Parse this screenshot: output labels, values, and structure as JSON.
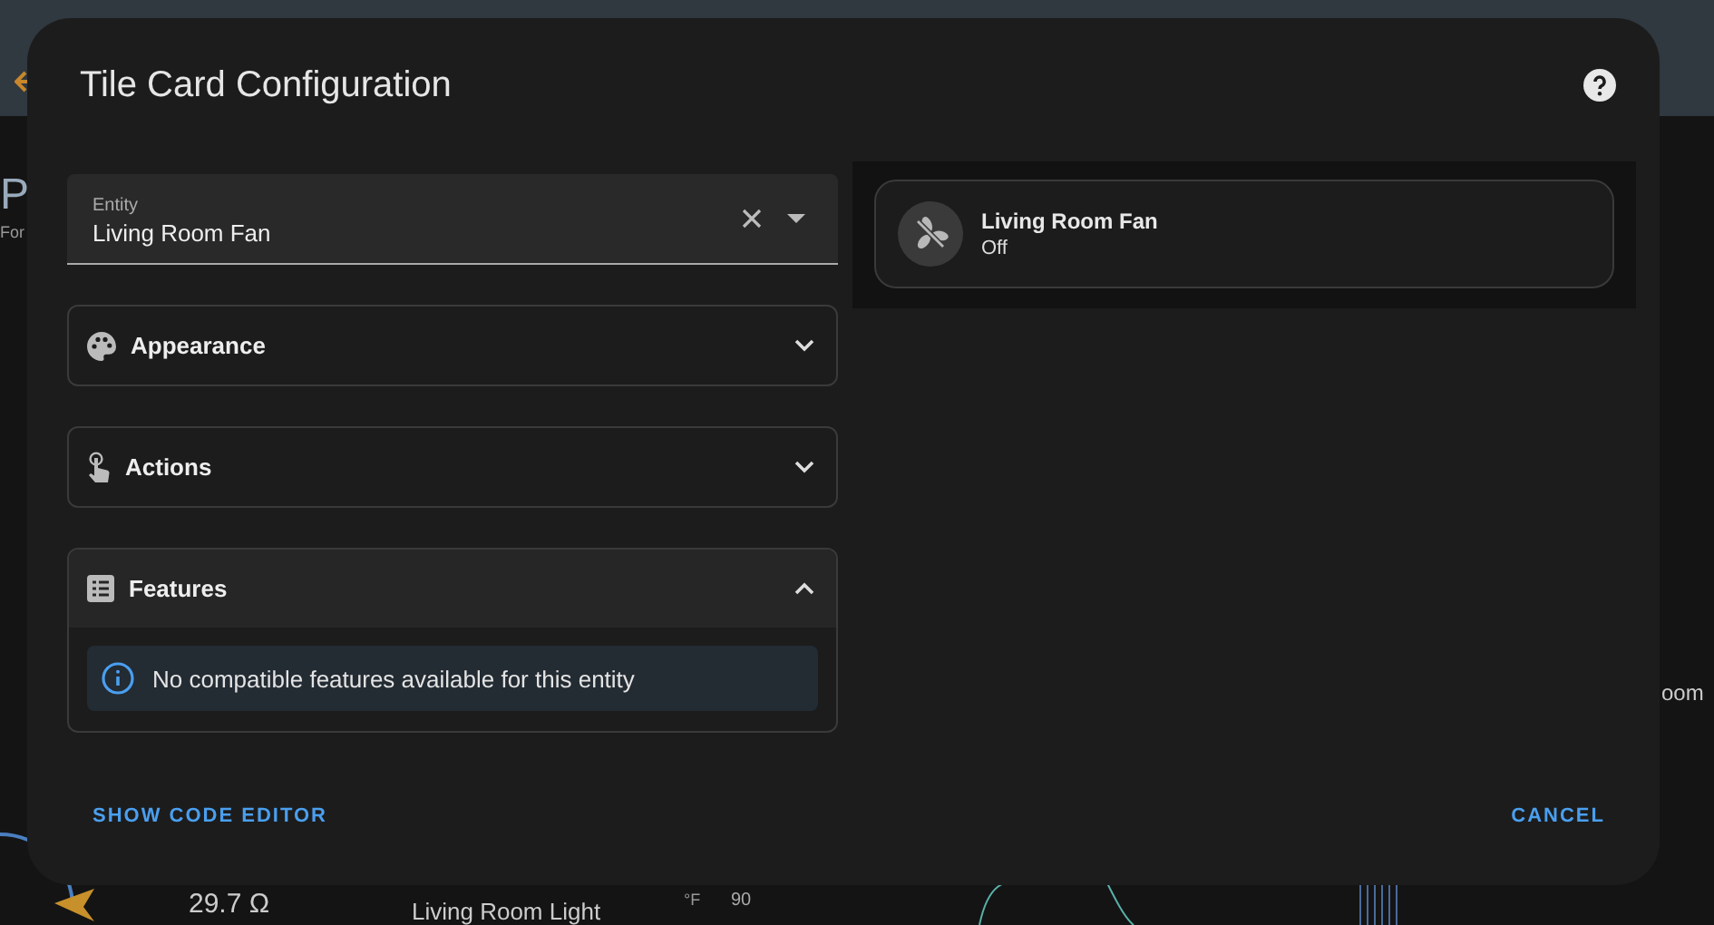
{
  "background": {
    "texts": [
      "P",
      "For",
      "29.7 Ω",
      "Living Room Light",
      "°F",
      "90",
      "oom"
    ]
  },
  "dialog": {
    "title": "Tile Card Configuration",
    "entity_field": {
      "label": "Entity",
      "value": "Living Room Fan"
    },
    "sections": [
      {
        "title": "Appearance",
        "kind": "palette",
        "expanded": false
      },
      {
        "title": "Actions",
        "kind": "gesture",
        "expanded": false
      },
      {
        "title": "Features",
        "kind": "list",
        "expanded": true
      }
    ],
    "features_message": "No compatible features available for this entity",
    "preview": {
      "name": "Living Room Fan",
      "state": "Off"
    },
    "buttons": [
      "SHOW CODE EDITOR",
      "CANCEL"
    ]
  }
}
